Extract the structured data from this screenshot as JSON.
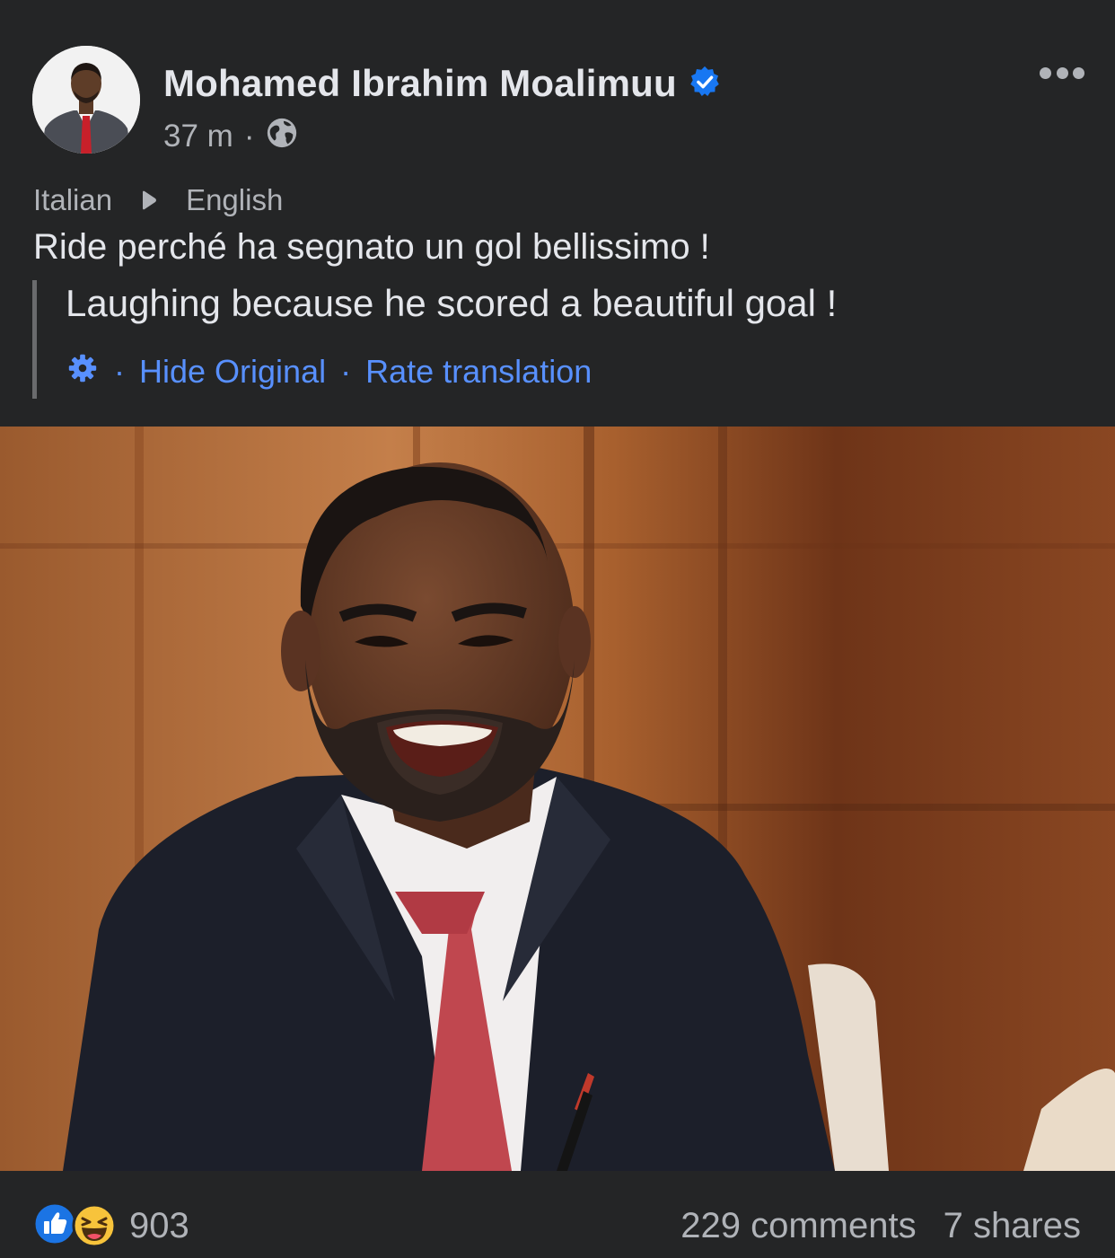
{
  "post": {
    "author": "Mohamed Ibrahim Moalimuu",
    "verified_icon": "verified-badge-icon",
    "timestamp": "37 m",
    "separator": "·",
    "audience_icon": "globe-icon",
    "more_icon": "more-options-icon"
  },
  "translation": {
    "source_language": "Italian",
    "target_language": "English",
    "original_text": "Ride perché ha segnato un gol bellissimo !",
    "translated_text": "Laughing because he scored a beautiful goal !",
    "settings_icon": "gear-icon",
    "hide_original": "Hide Original",
    "rate_translation": "Rate translation",
    "separator": "·"
  },
  "footer": {
    "reaction_icons": [
      "like-icon",
      "haha-icon"
    ],
    "reaction_count": "903",
    "comments": "229 comments",
    "shares": "7 shares"
  },
  "colors": {
    "background": "#242526",
    "text_primary": "#e4e6eb",
    "text_secondary": "#b0b3b8",
    "link": "#5890ff",
    "verified": "#1877f2"
  }
}
